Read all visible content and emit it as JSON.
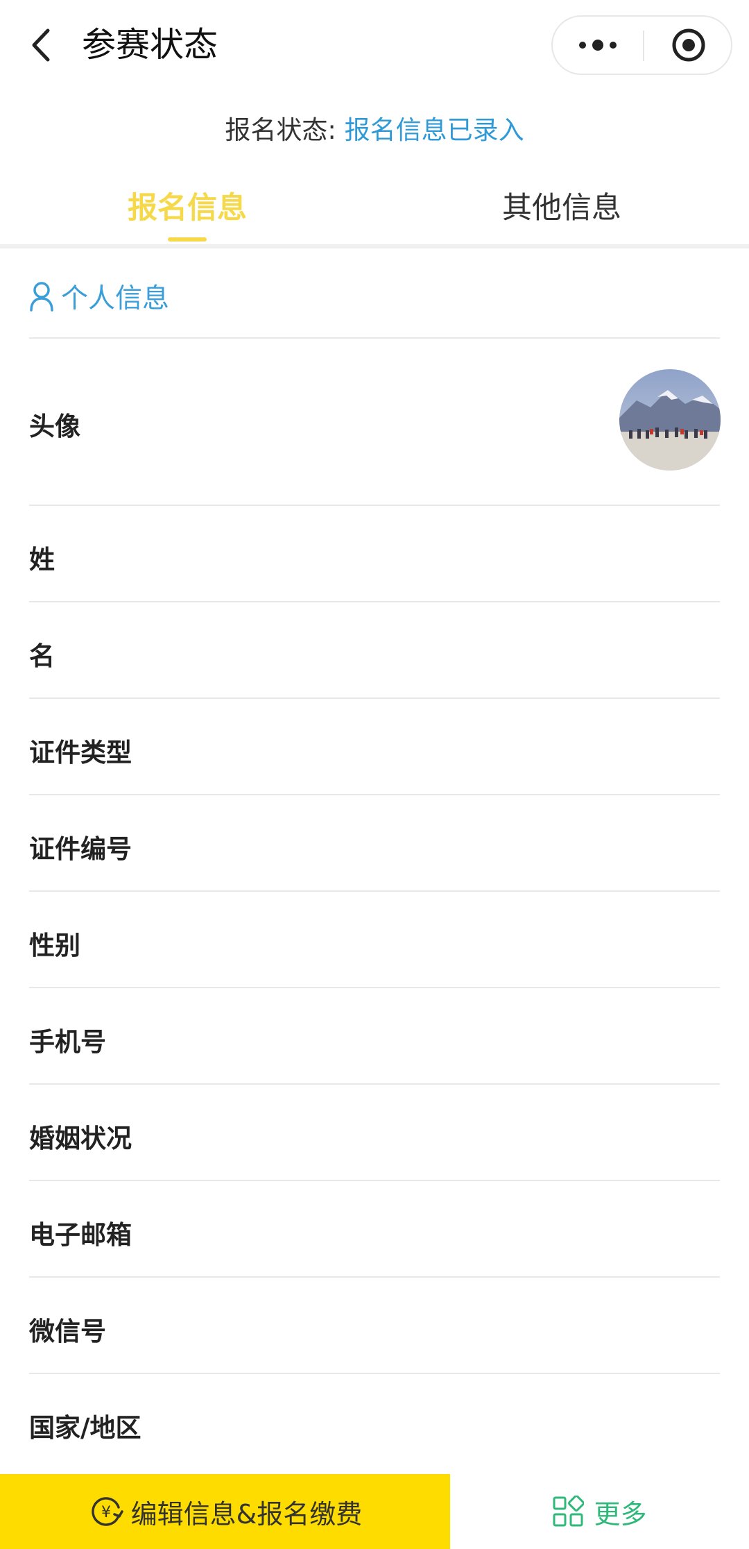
{
  "header": {
    "title": "参赛状态",
    "back_icon": "chevron-left-icon",
    "more_icon": "more-dots-icon",
    "close_icon": "target-icon"
  },
  "status": {
    "label": "报名状态: ",
    "value": "报名信息已录入"
  },
  "tabs": [
    {
      "label": "报名信息",
      "active": true
    },
    {
      "label": "其他信息",
      "active": false
    }
  ],
  "section": {
    "title": "个人信息",
    "icon": "user-icon"
  },
  "fields": [
    {
      "label": "头像"
    },
    {
      "label": "姓"
    },
    {
      "label": "名"
    },
    {
      "label": "证件类型"
    },
    {
      "label": "证件编号"
    },
    {
      "label": "性别"
    },
    {
      "label": "手机号"
    },
    {
      "label": "婚姻状况"
    },
    {
      "label": "电子邮箱"
    },
    {
      "label": "微信号"
    },
    {
      "label": "国家/地区"
    }
  ],
  "bottom_bar": {
    "edit_label": "编辑信息&报名缴费",
    "edit_icon": "yuan-refresh-icon",
    "more_label": "更多",
    "more_icon": "grid-icon"
  },
  "colors": {
    "accent_yellow": "#ffdc00",
    "tab_active": "#f5d94a",
    "link_blue": "#2f9ad6",
    "more_green": "#2fb87a"
  }
}
